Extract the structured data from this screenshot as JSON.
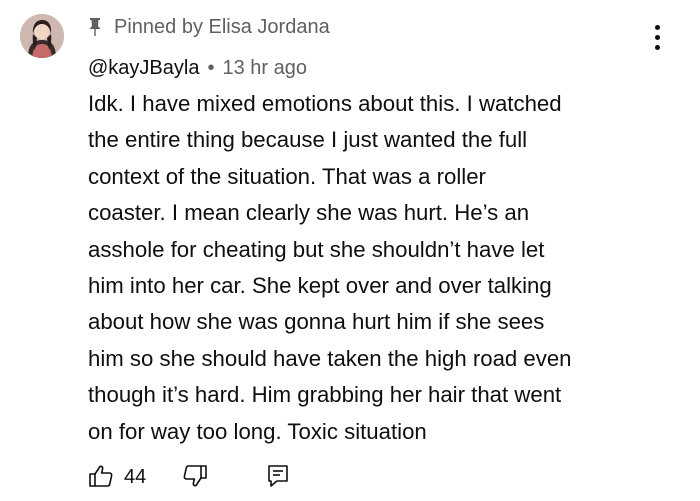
{
  "comment": {
    "pinned_label": "Pinned by Elisa Jordana",
    "author": "@kayJBayla",
    "separator": "•",
    "timestamp": "13 hr ago",
    "text": "Idk. I have mixed emotions about this. I watched\nthe entire thing because I just wanted the full\ncontext of the situation. That was a roller\ncoaster. I mean clearly she was hurt. He’s an\nasshole for cheating but she shouldn’t have let\nhim into her car. She kept over and over talking\nabout how she was gonna hurt him if she sees\nhim so she should have taken the high road even\nthough it’s hard. Him grabbing her hair that went\non for way too long. Toxic situation",
    "like_count": "44"
  },
  "icons": {
    "pin": "pin-icon",
    "menu": "more-vertical-icon",
    "like": "thumbs-up-icon",
    "dislike": "thumbs-down-icon",
    "reply": "reply-comment-icon"
  },
  "colors": {
    "text_primary": "#0f0f0f",
    "text_secondary": "#606060",
    "background": "#ffffff"
  }
}
